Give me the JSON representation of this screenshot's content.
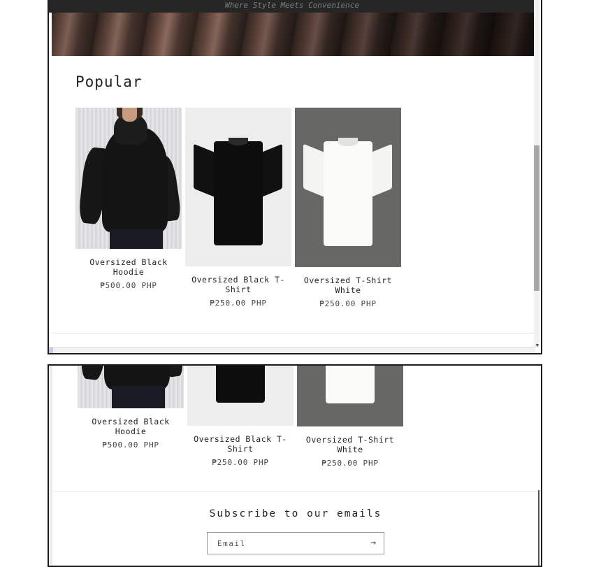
{
  "hero": {
    "tagline": "Where Style Meets Convenience"
  },
  "popular": {
    "title": "Popular",
    "products": [
      {
        "name": "Oversized Black Hoodie",
        "price": "₱500.00 PHP"
      },
      {
        "name": "Oversized Black T-Shirt",
        "price": "₱250.00 PHP"
      },
      {
        "name": "Oversized T-Shirt White",
        "price": "₱250.00 PHP"
      }
    ]
  },
  "newsletter": {
    "title": "Subscribe to our emails",
    "cut_title": "Subscribe to our emails",
    "email_placeholder": "Email",
    "submit_icon": "arrow-right-icon"
  },
  "colors": {
    "frame_border": "#1c1c1c",
    "hero_bar": "#262626",
    "scrollbar_thumb": "#a7a7a7"
  }
}
